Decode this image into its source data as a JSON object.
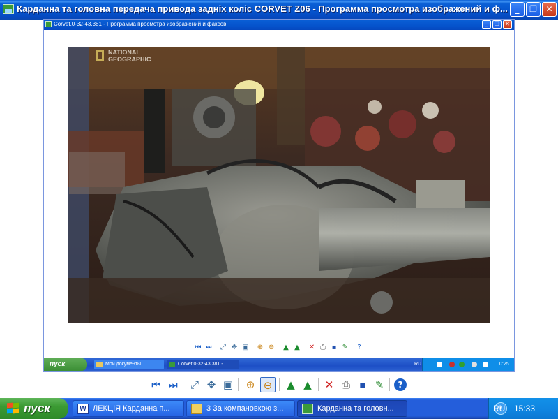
{
  "outer_window": {
    "title": "Карданна та головна передача привода задніх коліс CORVET Z06 - Программа просмотра изображений и ф...",
    "buttons": {
      "minimize": "_",
      "restore": "❐",
      "close": "✕"
    }
  },
  "inner_window": {
    "title": "Corvet.0-32-43.381 - Программа просмотра изображений и факсов",
    "buttons": {
      "minimize": "_",
      "restore": "❐",
      "close": "✕"
    }
  },
  "photo": {
    "logo_line1": "NATIONAL",
    "logo_line2": "GEOGRAPHIC"
  },
  "inner_taskbar": {
    "start_label": "пуск",
    "tasks": [
      {
        "label": "Мои документы",
        "icon": "folder-icon"
      },
      {
        "label": "Corvet.0-32-43.381 -...",
        "icon": "image-viewer-icon",
        "active": true
      }
    ],
    "tray": {
      "lang": "RU",
      "clock": "0:25"
    }
  },
  "toolbar_icons": [
    {
      "name": "previous-image-button",
      "glyph": "⏮",
      "color": "#1a5fc8"
    },
    {
      "name": "next-image-button",
      "glyph": "⏭",
      "color": "#1a5fc8"
    },
    {
      "name": "best-fit-button",
      "glyph": "⤢",
      "color": "#3a6b9a"
    },
    {
      "name": "actual-size-button",
      "glyph": "✥",
      "color": "#3a6b9a"
    },
    {
      "name": "slideshow-button",
      "glyph": "▣",
      "color": "#3a6b9a"
    },
    {
      "name": "zoom-in-button",
      "glyph": "⊕",
      "color": "#c88010"
    },
    {
      "name": "zoom-out-button",
      "glyph": "⊖",
      "color": "#c88010"
    },
    {
      "name": "rotate-clockwise-button",
      "glyph": "▲",
      "color": "#1b8c2e"
    },
    {
      "name": "rotate-counterclockwise-button",
      "glyph": "▲",
      "color": "#1b8c2e"
    },
    {
      "name": "delete-button",
      "glyph": "✕",
      "color": "#d02020"
    },
    {
      "name": "print-button",
      "glyph": "⎙",
      "color": "#606060"
    },
    {
      "name": "save-button",
      "glyph": "▪",
      "color": "#2050b0"
    },
    {
      "name": "edit-image-button",
      "glyph": "✎",
      "color": "#2a8a30"
    },
    {
      "name": "help-button",
      "glyph": "?",
      "color": "#1a5fc8"
    }
  ],
  "taskbar": {
    "start_label": "пуск",
    "tasks": [
      {
        "label": "ЛЕКЦІЯ Карданна п...",
        "icon": "word-document-icon"
      },
      {
        "label": "3 За компановкою з...",
        "icon": "folder-icon"
      },
      {
        "label": "Карданна та головн...",
        "icon": "image-viewer-icon",
        "active": true
      }
    ],
    "tray": {
      "lang": "RU",
      "clock": "15:33"
    }
  },
  "colors": {
    "titlebar_blue": "#0553cc",
    "taskbar_blue": "#245edb",
    "start_green": "#3b9a33",
    "tray_blue": "#0f84e0"
  }
}
